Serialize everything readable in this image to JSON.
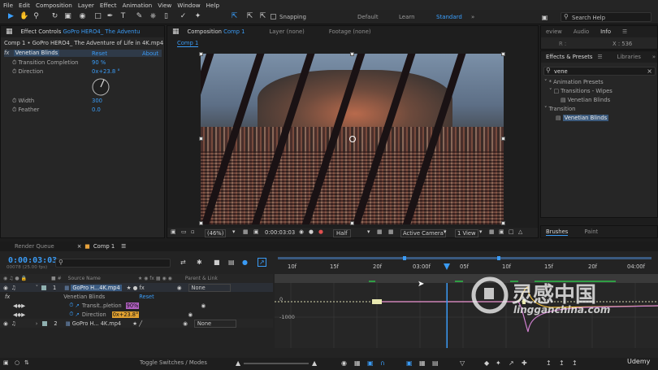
{
  "menu": [
    "File",
    "Edit",
    "Composition",
    "Layer",
    "Effect",
    "Animation",
    "View",
    "Window",
    "Help"
  ],
  "toolbar": {
    "snapping": "Snapping",
    "workspaces": [
      "Default",
      "Learn",
      "Standard"
    ],
    "active_workspace": "Standard",
    "search_help": "Search Help"
  },
  "effect_controls": {
    "tab": "Effect Controls",
    "tab_file": "GoPro HERO4_ The Adventu",
    "source": "Comp 1 • GoPro HERO4_ The Adventure of Life in 4K.mp4",
    "effect_name": "Venetian Blinds",
    "reset": "Reset",
    "about": "About",
    "fx_label": "fx",
    "props": [
      {
        "name": "Transition Completion",
        "value": "90 %"
      },
      {
        "name": "Direction",
        "value": "0x+23.8 °"
      },
      {
        "name": "Width",
        "value": "300"
      },
      {
        "name": "Feather",
        "value": "0.0"
      }
    ]
  },
  "composition": {
    "tab": "Composition",
    "tab_name": "Comp 1",
    "layer_tab": "Layer (none)",
    "footage_tab": "Footage (none)",
    "sub_tab": "Comp 1",
    "zoom": "(46%)",
    "timecode": "0:00:03:03",
    "resolution": "Half",
    "camera": "Active Camera",
    "views": "1 View"
  },
  "info_panel": {
    "tabs": [
      "eview",
      "Audio",
      "Info"
    ],
    "r_label": "R :",
    "x_label": "X : 536"
  },
  "effects_presets": {
    "tab": "Effects & Presets",
    "tab2": "Libraries",
    "search_value": "vene",
    "tree": [
      {
        "label": "* Animation Presets",
        "indent": 0
      },
      {
        "label": "Transitions - Wipes",
        "indent": 1
      },
      {
        "label": "Venetian Blinds",
        "indent": 2
      },
      {
        "label": "Transition",
        "indent": 0
      },
      {
        "label": "Venetian Blinds",
        "indent": 1,
        "selected": true
      }
    ]
  },
  "brushes_panel": {
    "tabs": [
      "Brushes",
      "Paint"
    ]
  },
  "timeline": {
    "tabs": [
      "Render Queue",
      "Comp 1"
    ],
    "timecode": "0:00:03:03",
    "frame_info": "00078 (25.00 fps)",
    "search_icon": "search-icon",
    "col_source": "Source Name",
    "col_parent": "Parent & Link",
    "layers": [
      {
        "num": "1",
        "name": "GoPro H...4K.mp4",
        "parent": "None"
      },
      {
        "num": "2",
        "name": "GoPro H... 4K.mp4",
        "parent": "None"
      }
    ],
    "effect_row": "Venetian Blinds",
    "effect_reset": "Reset",
    "prop_rows": [
      {
        "name": "Transit..pletion",
        "value": "90%"
      },
      {
        "name": "Direction",
        "value": "0x+23.8°"
      }
    ],
    "ruler_labels": [
      "10f",
      "15f",
      "20f",
      "03:00f",
      "05f",
      "10f",
      "15f",
      "20f",
      "04:00f"
    ],
    "graph_labels": [
      "0",
      "-1000"
    ],
    "toggle_label": "Toggle Switches / Modes"
  },
  "watermark": {
    "chinese": "灵感中国",
    "domain": "lingganchina.com"
  },
  "udemy": "Udemy"
}
